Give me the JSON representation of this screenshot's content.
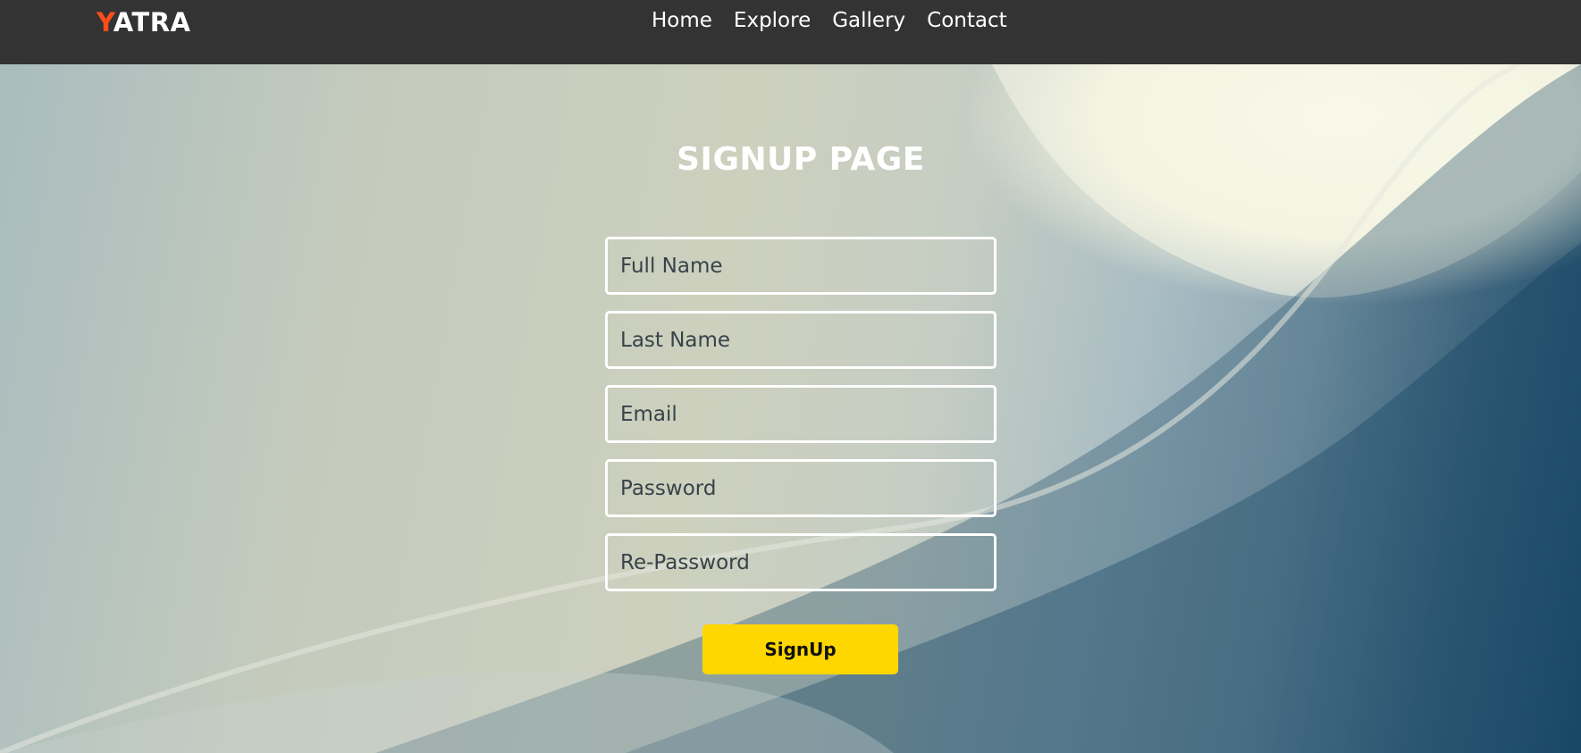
{
  "navbar": {
    "logo_first": "Y",
    "logo_rest": "ATRA",
    "links": [
      "Home",
      "Explore",
      "Gallery",
      "Contact"
    ]
  },
  "main": {
    "title": "SIGNUP PAGE",
    "fields": [
      {
        "placeholder": "Full Name",
        "value": ""
      },
      {
        "placeholder": "Last Name",
        "value": ""
      },
      {
        "placeholder": "Email",
        "value": ""
      },
      {
        "placeholder": "Password",
        "value": ""
      },
      {
        "placeholder": "Re-Password",
        "value": ""
      }
    ],
    "submit_label": "SignUp"
  },
  "colors": {
    "navbar_bg": "#333333",
    "logo_accent": "#ff4d1a",
    "button_bg": "#ffd700",
    "field_border": "#ffffff"
  }
}
